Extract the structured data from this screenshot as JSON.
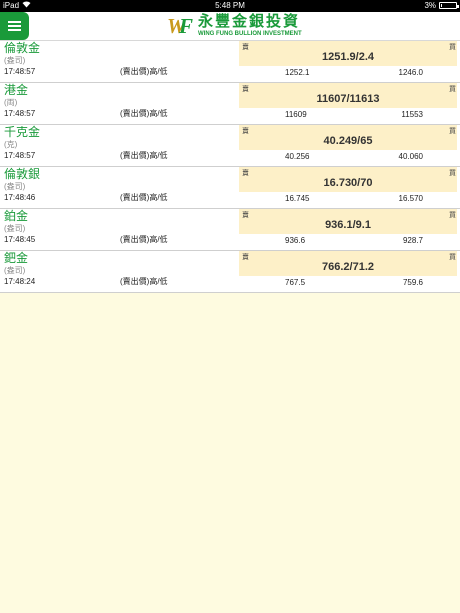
{
  "status_bar": {
    "device": "iPad",
    "time": "5:48 PM",
    "battery_text": "3%",
    "battery_level": 0.03
  },
  "header": {
    "logo_mark_w": "W",
    "logo_mark_f": "F",
    "logo_cn": "永豐金銀投資",
    "logo_en": "WING FUNG BULLION INVESTMENT"
  },
  "labels": {
    "buy": "買",
    "sell": "賣",
    "range_caption": "(賣出價)高/低"
  },
  "quotes": [
    {
      "name": "倫敦金",
      "sub": "(盎司)",
      "time": "17:48:57",
      "quote": "1251.9/2.4",
      "high": "1252.1",
      "low": "1246.0"
    },
    {
      "name": "港金",
      "sub": "(両)",
      "time": "17:48:57",
      "quote": "11607/11613",
      "high": "11609",
      "low": "11553"
    },
    {
      "name": "千克金",
      "sub": "(克)",
      "time": "17:48:57",
      "quote": "40.249/65",
      "high": "40.256",
      "low": "40.060"
    },
    {
      "name": "倫敦銀",
      "sub": "(盎司)",
      "time": "17:48:46",
      "quote": "16.730/70",
      "high": "16.745",
      "low": "16.570"
    },
    {
      "name": "鉑金",
      "sub": "(盎司)",
      "time": "17:48:45",
      "quote": "936.1/9.1",
      "high": "936.6",
      "low": "928.7"
    },
    {
      "name": "鈀金",
      "sub": "(盎司)",
      "time": "17:48:24",
      "quote": "766.2/71.2",
      "high": "767.5",
      "low": "759.6"
    }
  ]
}
